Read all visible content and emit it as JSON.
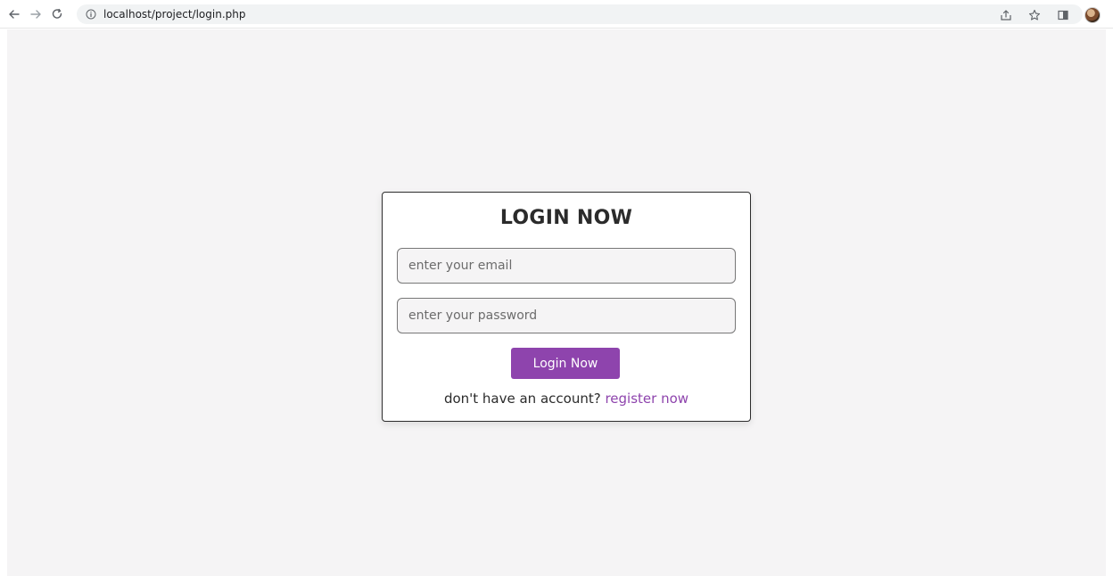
{
  "browser": {
    "url": "localhost/project/login.php"
  },
  "login": {
    "title": "LOGIN NOW",
    "email_placeholder": "enter your email",
    "password_placeholder": "enter your password",
    "button_label": "Login Now",
    "register_prompt": "don't have an account?",
    "register_link": "register now"
  },
  "icons": {
    "back": "back-arrow-icon",
    "forward": "forward-arrow-icon",
    "reload": "reload-icon",
    "info": "info-icon",
    "share": "share-icon",
    "bookmark": "star-icon",
    "side_panel": "side-panel-icon",
    "profile": "avatar"
  },
  "colors": {
    "page_background": "#f5f4f5",
    "accent": "#8e44ad"
  }
}
